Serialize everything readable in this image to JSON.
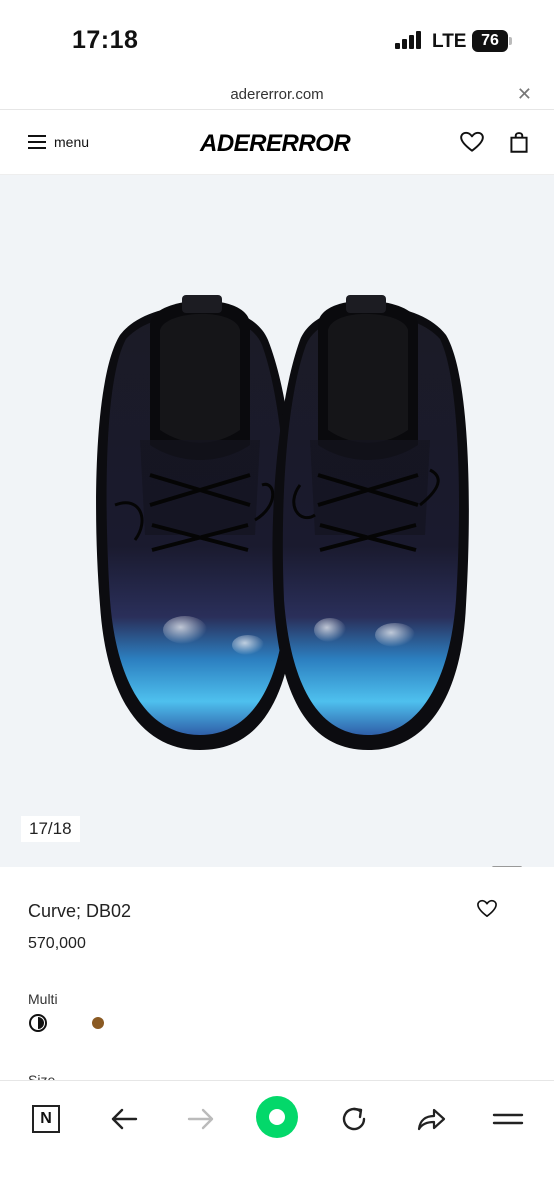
{
  "status_bar": {
    "time": "17:18",
    "network": "LTE",
    "battery": "76"
  },
  "browser": {
    "url": "adererror.com"
  },
  "header": {
    "menu_label": "menu",
    "brand": "ADERERROR"
  },
  "gallery": {
    "counter": "17/18"
  },
  "product": {
    "name": "Curve; DB02",
    "price": "570,000",
    "color_label": "Multi",
    "size_label": "Size",
    "swatch_colors": [
      "#111111",
      "#8a5a23"
    ]
  },
  "toolbar": {
    "n_label": "N",
    "accent": "#03d86a"
  }
}
